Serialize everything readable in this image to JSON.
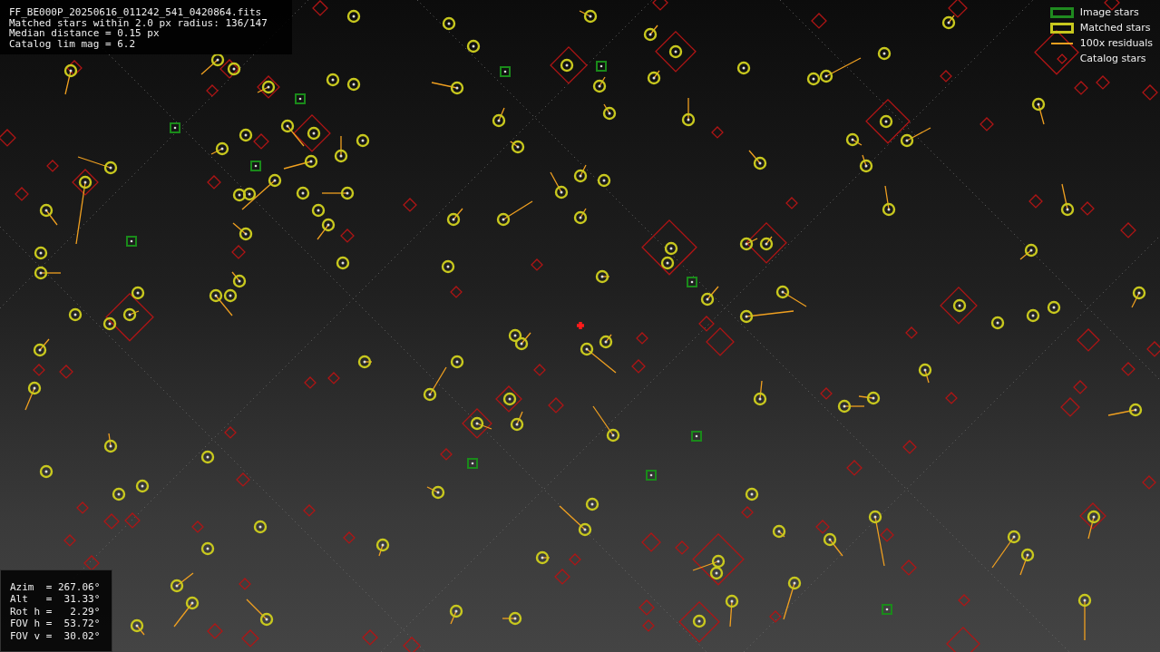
{
  "info": {
    "lines": [
      "FF_BE000P_20250616_011242_541_0420864.fits",
      "Matched stars within 2.0 px radius: 136/147",
      "Median distance = 0.15 px",
      "Catalog lim mag = 6.2"
    ]
  },
  "legend": [
    {
      "kind": "box",
      "label": "Image stars",
      "color": "#1f8a1f"
    },
    {
      "kind": "box",
      "label": "Matched stars",
      "color": "#c8c81e"
    },
    {
      "kind": "line",
      "label": "100x residuals",
      "color": "#f0a020"
    },
    {
      "kind": "diamond",
      "label": "Catalog stars",
      "color": "#c01818"
    }
  ],
  "pointing": {
    "lines": [
      "Azim  = 267.06°",
      "Alt   =  31.33°",
      "Rot h =   2.29°",
      "FOV h =  53.72°",
      "FOV v =  30.02°"
    ]
  }
}
